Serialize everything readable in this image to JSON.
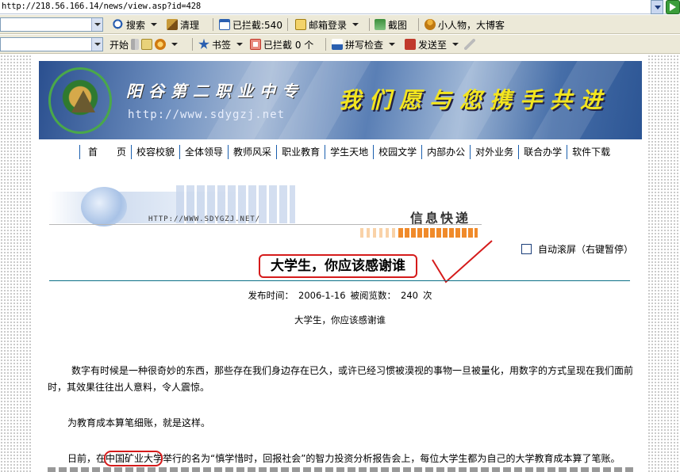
{
  "browser": {
    "address": "http://218.56.166.14/news/view.asp?id=428"
  },
  "toolbar1": {
    "search": "搜索",
    "clear": "清理",
    "blocked": "已拦截:540",
    "mail_login": "邮箱登录",
    "screenshot": "截图",
    "tip": "小人物，大博客"
  },
  "toolbar2": {
    "start": "开始",
    "bookmarks": "书签",
    "blocked": "已拦截 0 个",
    "spellcheck": "拼写检查",
    "send_to": "发送至"
  },
  "banner": {
    "school_name": "阳谷第二职业中专",
    "url": "http://www.sdygzj.net",
    "slogan": "我们愿与您携手共进"
  },
  "nav": {
    "items": [
      "首　　页",
      "校容校貌",
      "全体领导",
      "教师风采",
      "职业教育",
      "学生天地",
      "校园文学",
      "内部办公",
      "对外业务",
      "联合办学",
      "软件下载"
    ]
  },
  "section": {
    "url": "HTTP://WWW.SDYGZJ.NET/",
    "title": "信息快递"
  },
  "article": {
    "autoscroll_label": "自动滚屏（右键暂停）",
    "title": "大学生，你应该感谢谁",
    "publish_label": "发布时间：",
    "publish_date": "2006-1-16",
    "views_label": "被阅览数：",
    "views": "240",
    "views_unit": "次",
    "subtitle": "大学生，你应该感谢谁",
    "p1": "数字有时候是一种很奇妙的东西，那些存在我们身边存在已久，或许已经习惯被漠视的事物一旦被量化，用数字的方式呈现在我们面前时，其效果往往出人意料，令人震惊。",
    "p2": "为教育成本算笔细账，就是这样。",
    "p3": "日前，在中国矿业大学举行的名为“慎学惜时，回报社会”的智力投资分析报告会上，每位大学生都为自己的大学教育成本算了笔账。"
  },
  "colors": {
    "annotation_red": "#d51b1b",
    "nav_divider": "#1a5fae",
    "rule_teal": "#0b6f86",
    "slogan_yellow": "#f3e51f"
  }
}
